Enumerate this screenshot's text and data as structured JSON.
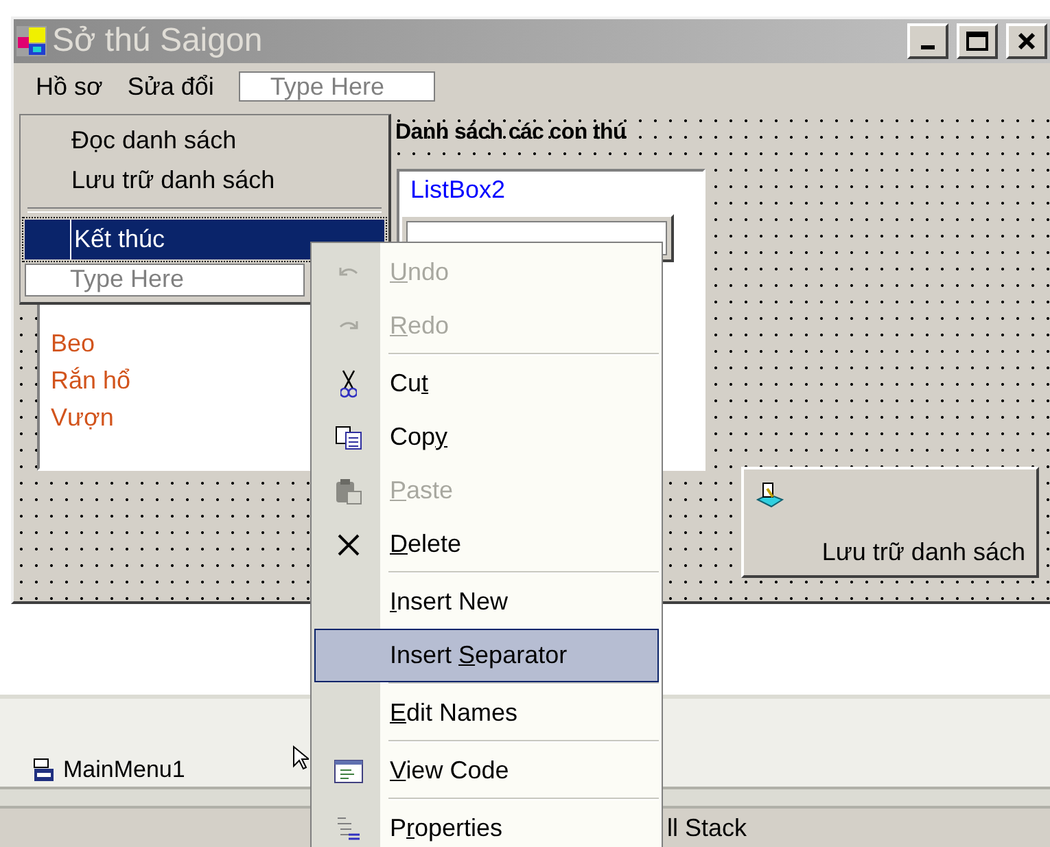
{
  "window": {
    "title": "Sở thú Saigon"
  },
  "menu_bar": {
    "items": [
      "Hồ sơ",
      "Sửa đổi"
    ],
    "placeholder": "Type Here"
  },
  "dropdown": {
    "items": [
      {
        "kind": "item",
        "label": "Đọc danh sách",
        "selected": false
      },
      {
        "kind": "item",
        "label": "Lưu trữ danh sách",
        "selected": false
      },
      {
        "kind": "separator"
      },
      {
        "kind": "item",
        "label": "Kết thúc",
        "selected": true
      },
      {
        "kind": "field",
        "placeholder": "Type Here"
      }
    ]
  },
  "label": "Danh sách các con thú",
  "listbox2": {
    "text": "ListBox2"
  },
  "listbox1": {
    "items": [
      "Beo",
      "Rắn hổ",
      "Vượn"
    ]
  },
  "save_button": {
    "label": "Lưu trữ danh sách"
  },
  "component_tray": {
    "items": [
      "MainMenu1"
    ]
  },
  "bottom_bar": {
    "text": "ll Stack"
  },
  "context_menu": {
    "items": [
      {
        "kind": "item",
        "key": "U",
        "post": "ndo",
        "disabled": true,
        "selected": false
      },
      {
        "kind": "item",
        "key": "R",
        "post": "edo",
        "disabled": true,
        "selected": false
      },
      {
        "kind": "separator"
      },
      {
        "kind": "item",
        "pre": "Cu",
        "key": "t",
        "disabled": false,
        "selected": false
      },
      {
        "kind": "item",
        "pre": "Cop",
        "key": "y",
        "disabled": false,
        "selected": false
      },
      {
        "kind": "item",
        "key": "P",
        "post": "aste",
        "disabled": true,
        "selected": false
      },
      {
        "kind": "item",
        "key": "D",
        "post": "elete",
        "disabled": false,
        "selected": false
      },
      {
        "kind": "separator"
      },
      {
        "kind": "item",
        "key": "I",
        "post": "nsert New",
        "disabled": false,
        "selected": false
      },
      {
        "kind": "item",
        "pre": "Insert ",
        "key": "S",
        "post": "eparator",
        "disabled": false,
        "selected": true
      },
      {
        "kind": "separator"
      },
      {
        "kind": "item",
        "key": "E",
        "post": "dit Names",
        "disabled": false,
        "selected": false
      },
      {
        "kind": "separator"
      },
      {
        "kind": "item",
        "key": "V",
        "post": "iew Code",
        "disabled": false,
        "selected": false
      },
      {
        "kind": "separator"
      },
      {
        "kind": "item",
        "pre": "P",
        "key": "r",
        "post": "operties",
        "disabled": false,
        "selected": false
      }
    ]
  }
}
